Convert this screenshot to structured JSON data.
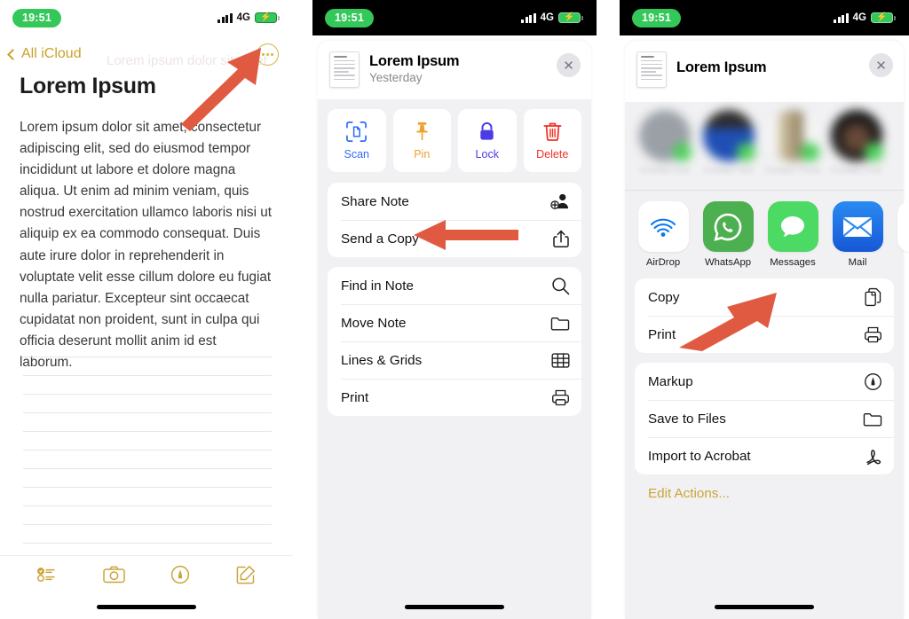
{
  "status_bar": {
    "time": "19:51",
    "network": "4G",
    "battery_charging": true
  },
  "colors": {
    "accent_gold": "#caa53a",
    "arrow_red": "#e05a41",
    "status_green": "#34c759",
    "scan_blue": "#2f6df6",
    "pin_orange": "#f0a030",
    "lock_purple": "#4b3ce8",
    "delete_red": "#f03125"
  },
  "panel1": {
    "back_label": "All iCloud",
    "more_icon": "ellipsis-circle-icon",
    "ghost_text": "Lorem ipsum dolor sit amet",
    "title": "Lorem Ipsum",
    "body": "Lorem ipsum dolor sit amet, consectetur adipiscing elit, sed do eiusmod tempor incididunt ut labore et dolore magna aliqua. Ut enim ad minim veniam, quis nostrud exercitation ullamco laboris nisi ut aliquip ex ea commodo consequat. Duis aute irure dolor in reprehenderit in voluptate velit esse cillum dolore eu fugiat nulla pariatur. Excepteur sint occaecat cupidatat non proident, sunt in culpa qui officia deserunt mollit anim id est laborum.",
    "toolbar": [
      {
        "name": "checklist-icon",
        "label": "Checklist"
      },
      {
        "name": "camera-icon",
        "label": "Camera"
      },
      {
        "name": "markup-pen-icon",
        "label": "Markup"
      },
      {
        "name": "compose-icon",
        "label": "Compose"
      }
    ]
  },
  "panel2": {
    "sheet_title": "Lorem Ipsum",
    "sheet_subtitle": "Yesterday",
    "close_label": "✕",
    "tiles": [
      {
        "label": "Scan",
        "icon": "scan-document-icon",
        "color": "#2f6df6"
      },
      {
        "label": "Pin",
        "icon": "pin-icon",
        "color": "#f0a030"
      },
      {
        "label": "Lock",
        "icon": "lock-icon",
        "color": "#4b3ce8"
      },
      {
        "label": "Delete",
        "icon": "trash-icon",
        "color": "#f03125"
      }
    ],
    "group1": [
      {
        "label": "Share Note",
        "icon": "share-person-icon"
      },
      {
        "label": "Send a Copy",
        "icon": "share-up-icon"
      }
    ],
    "group2": [
      {
        "label": "Find in Note",
        "icon": "search-icon"
      },
      {
        "label": "Move Note",
        "icon": "folder-icon"
      },
      {
        "label": "Lines & Grids",
        "icon": "grid-icon"
      },
      {
        "label": "Print",
        "icon": "printer-icon"
      }
    ]
  },
  "panel3": {
    "sheet_title": "Lorem Ipsum",
    "close_label": "✕",
    "contacts": [
      {
        "name": "Contact One",
        "color": "#9aa0a6"
      },
      {
        "name": "Contact Two",
        "color": "#1f4fb5"
      },
      {
        "name": "Contact Three",
        "color": "#d7c9a8"
      },
      {
        "name": "Contact Four",
        "color": "#161616"
      }
    ],
    "apps": [
      {
        "label": "AirDrop",
        "icon": "airdrop-icon"
      },
      {
        "label": "WhatsApp",
        "icon": "whatsapp-icon"
      },
      {
        "label": "Messages",
        "icon": "messages-icon"
      },
      {
        "label": "Mail",
        "icon": "mail-icon"
      },
      {
        "label": "D",
        "icon": "drive-icon"
      }
    ],
    "group1": [
      {
        "label": "Copy",
        "icon": "copy-icon"
      },
      {
        "label": "Print",
        "icon": "printer-icon"
      }
    ],
    "group2": [
      {
        "label": "Markup",
        "icon": "markup-pen-icon"
      },
      {
        "label": "Save to Files",
        "icon": "folder-icon"
      },
      {
        "label": "Import to Acrobat",
        "icon": "acrobat-icon"
      }
    ],
    "edit_actions": "Edit Actions..."
  }
}
